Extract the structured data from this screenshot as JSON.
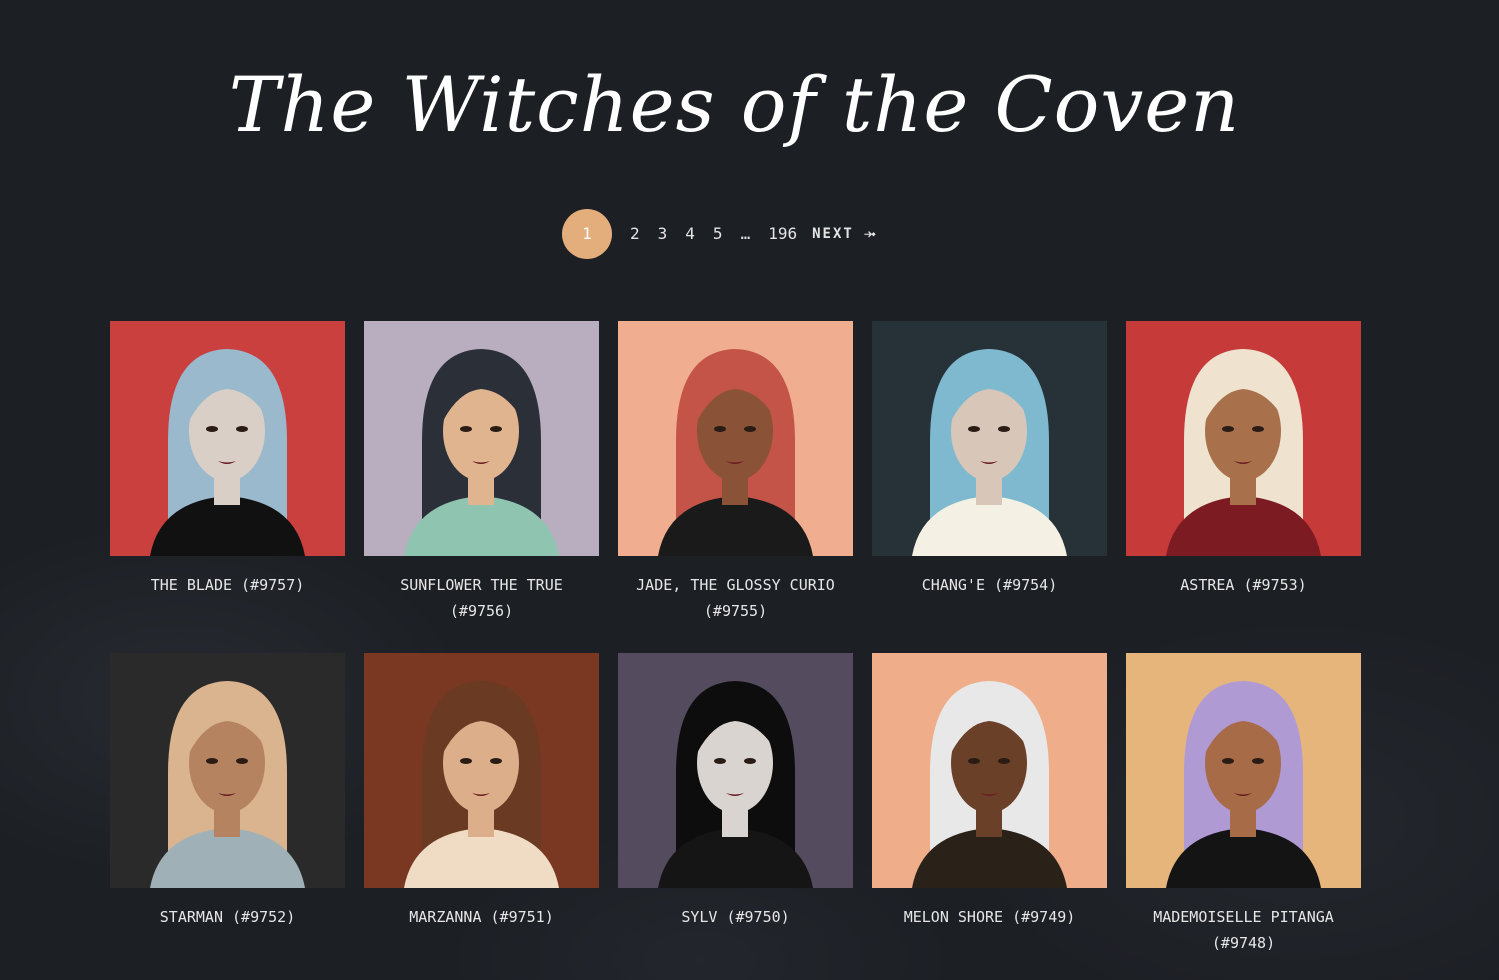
{
  "page": {
    "title": "The Witches of the Coven"
  },
  "pagination": {
    "pages": [
      "1",
      "2",
      "3",
      "4",
      "5",
      "…",
      "196"
    ],
    "current": "1",
    "next_label": "NEXT ⤞"
  },
  "cards": [
    {
      "name": "THE BLADE (#9757)",
      "bg": "#c9403f",
      "hair": "#9ab9cc",
      "skin": "#d9cfc6",
      "top": "#111111"
    },
    {
      "name": "SUNFLOWER THE TRUE (#9756)",
      "bg": "#b9aec0",
      "hair": "#2b3038",
      "skin": "#e0b48f",
      "top": "#8ec4b0"
    },
    {
      "name": "JADE, THE GLOSSY CURIO (#9755)",
      "bg": "#f0ad8f",
      "hair": "#c45448",
      "skin": "#8a5236",
      "top": "#1a1a1a"
    },
    {
      "name": "CHANG'E (#9754)",
      "bg": "#263238",
      "hair": "#7fb9cf",
      "skin": "#d8c6b8",
      "top": "#f4f0e4"
    },
    {
      "name": "ASTREA (#9753)",
      "bg": "#c63a3a",
      "hair": "#efe3cf",
      "skin": "#a8714c",
      "top": "#7d1b22"
    },
    {
      "name": "STARMAN (#9752)",
      "bg": "#2a2a2a",
      "hair": "#d9b48e",
      "skin": "#b58360",
      "top": "#9fb0b6"
    },
    {
      "name": "MARZANNA (#9751)",
      "bg": "#7a3822",
      "hair": "#6a3a22",
      "skin": "#dcae8a",
      "top": "#f0dcc4"
    },
    {
      "name": "SYLV (#9750)",
      "bg": "#544c5e",
      "hair": "#0d0d0d",
      "skin": "#d9d4cf",
      "top": "#151515"
    },
    {
      "name": "MELON SHORE (#9749)",
      "bg": "#efad8a",
      "hair": "#e8e8e8",
      "skin": "#6b4028",
      "top": "#2a2219"
    },
    {
      "name": "MADEMOISELLE PITANGA (#9748)",
      "bg": "#e6b57c",
      "hair": "#b09ad4",
      "skin": "#a76b47",
      "top": "#141414"
    }
  ]
}
